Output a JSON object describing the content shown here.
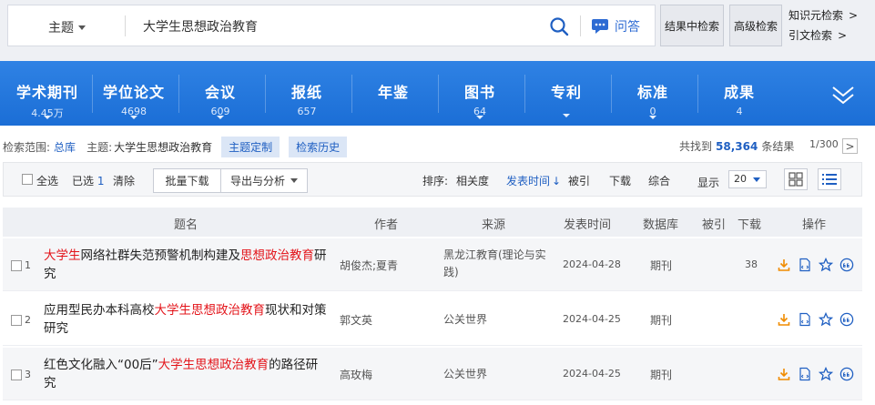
{
  "search": {
    "field": "主题",
    "query": "大学生思想政治教育",
    "qa_label": "问答",
    "within_label": "结果中检索",
    "advanced_label": "高级检索",
    "side_links": [
      "知识元检索",
      "引文检索"
    ],
    "arrow": ">"
  },
  "categories": [
    {
      "label": "学术期刊",
      "count": "4.45万"
    },
    {
      "label": "学位论文",
      "count": "4698"
    },
    {
      "label": "会议",
      "count": "609"
    },
    {
      "label": "报纸",
      "count": "657"
    },
    {
      "label": "年鉴",
      "count": ""
    },
    {
      "label": "图书",
      "count": "64"
    },
    {
      "label": "专利",
      "count": ""
    },
    {
      "label": "标准",
      "count": "0"
    },
    {
      "label": "成果",
      "count": "4"
    }
  ],
  "scope": {
    "label": "检索范围:",
    "all_db": "总库",
    "topic_label": "主题:",
    "topic_value": "大学生思想政治教育",
    "custom_btn": "主题定制",
    "history_btn": "检索历史",
    "found_prefix": "共找到",
    "found_count": "58,364",
    "found_suffix": "条结果",
    "page": "1/300",
    "next": ">"
  },
  "toolbar": {
    "select_all": "全选",
    "selected": "已选",
    "selected_count": "1",
    "clear": "清除",
    "batch_download": "批量下载",
    "export": "导出与分析",
    "sort_label": "排序:",
    "sort_relevance": "相关度",
    "sort_date": "发表时间",
    "sort_cite": "被引",
    "sort_download": "下载",
    "sort_overall": "综合",
    "display_label": "显示",
    "display_value": "20"
  },
  "table": {
    "headers": {
      "title": "题名",
      "author": "作者",
      "source": "来源",
      "date": "发表时间",
      "db": "数据库",
      "cited": "被引",
      "download": "下载",
      "ops": "操作"
    },
    "rows": [
      {
        "num": "1",
        "title_parts": [
          "大学生",
          "网络社群失范预警机制构建及",
          "思想政治教育",
          "研究"
        ],
        "author": "胡俊杰;夏青",
        "source": "黑龙江教育(理论与实践)",
        "date": "2024-04-28",
        "db": "期刊",
        "cited": "",
        "download": "38"
      },
      {
        "num": "2",
        "title_parts": [
          "",
          "应用型民办本科高校",
          "大学生思想政治教育",
          "现状和对策研究"
        ],
        "author": "郭文英",
        "source": "公关世界",
        "date": "2024-04-25",
        "db": "期刊",
        "cited": "",
        "download": ""
      },
      {
        "num": "3",
        "title_parts": [
          "",
          "红色文化融入“00后”",
          "大学生思想政治教育",
          "的路径研究"
        ],
        "author": "高玫梅",
        "source": "公关世界",
        "date": "2024-04-25",
        "db": "期刊",
        "cited": "",
        "download": ""
      }
    ]
  },
  "colors": {
    "accent": "#1f5fc2",
    "nav_blue": "#1b6ed6",
    "highlight_red": "#e3141a",
    "icon_orange": "#f08c00"
  }
}
